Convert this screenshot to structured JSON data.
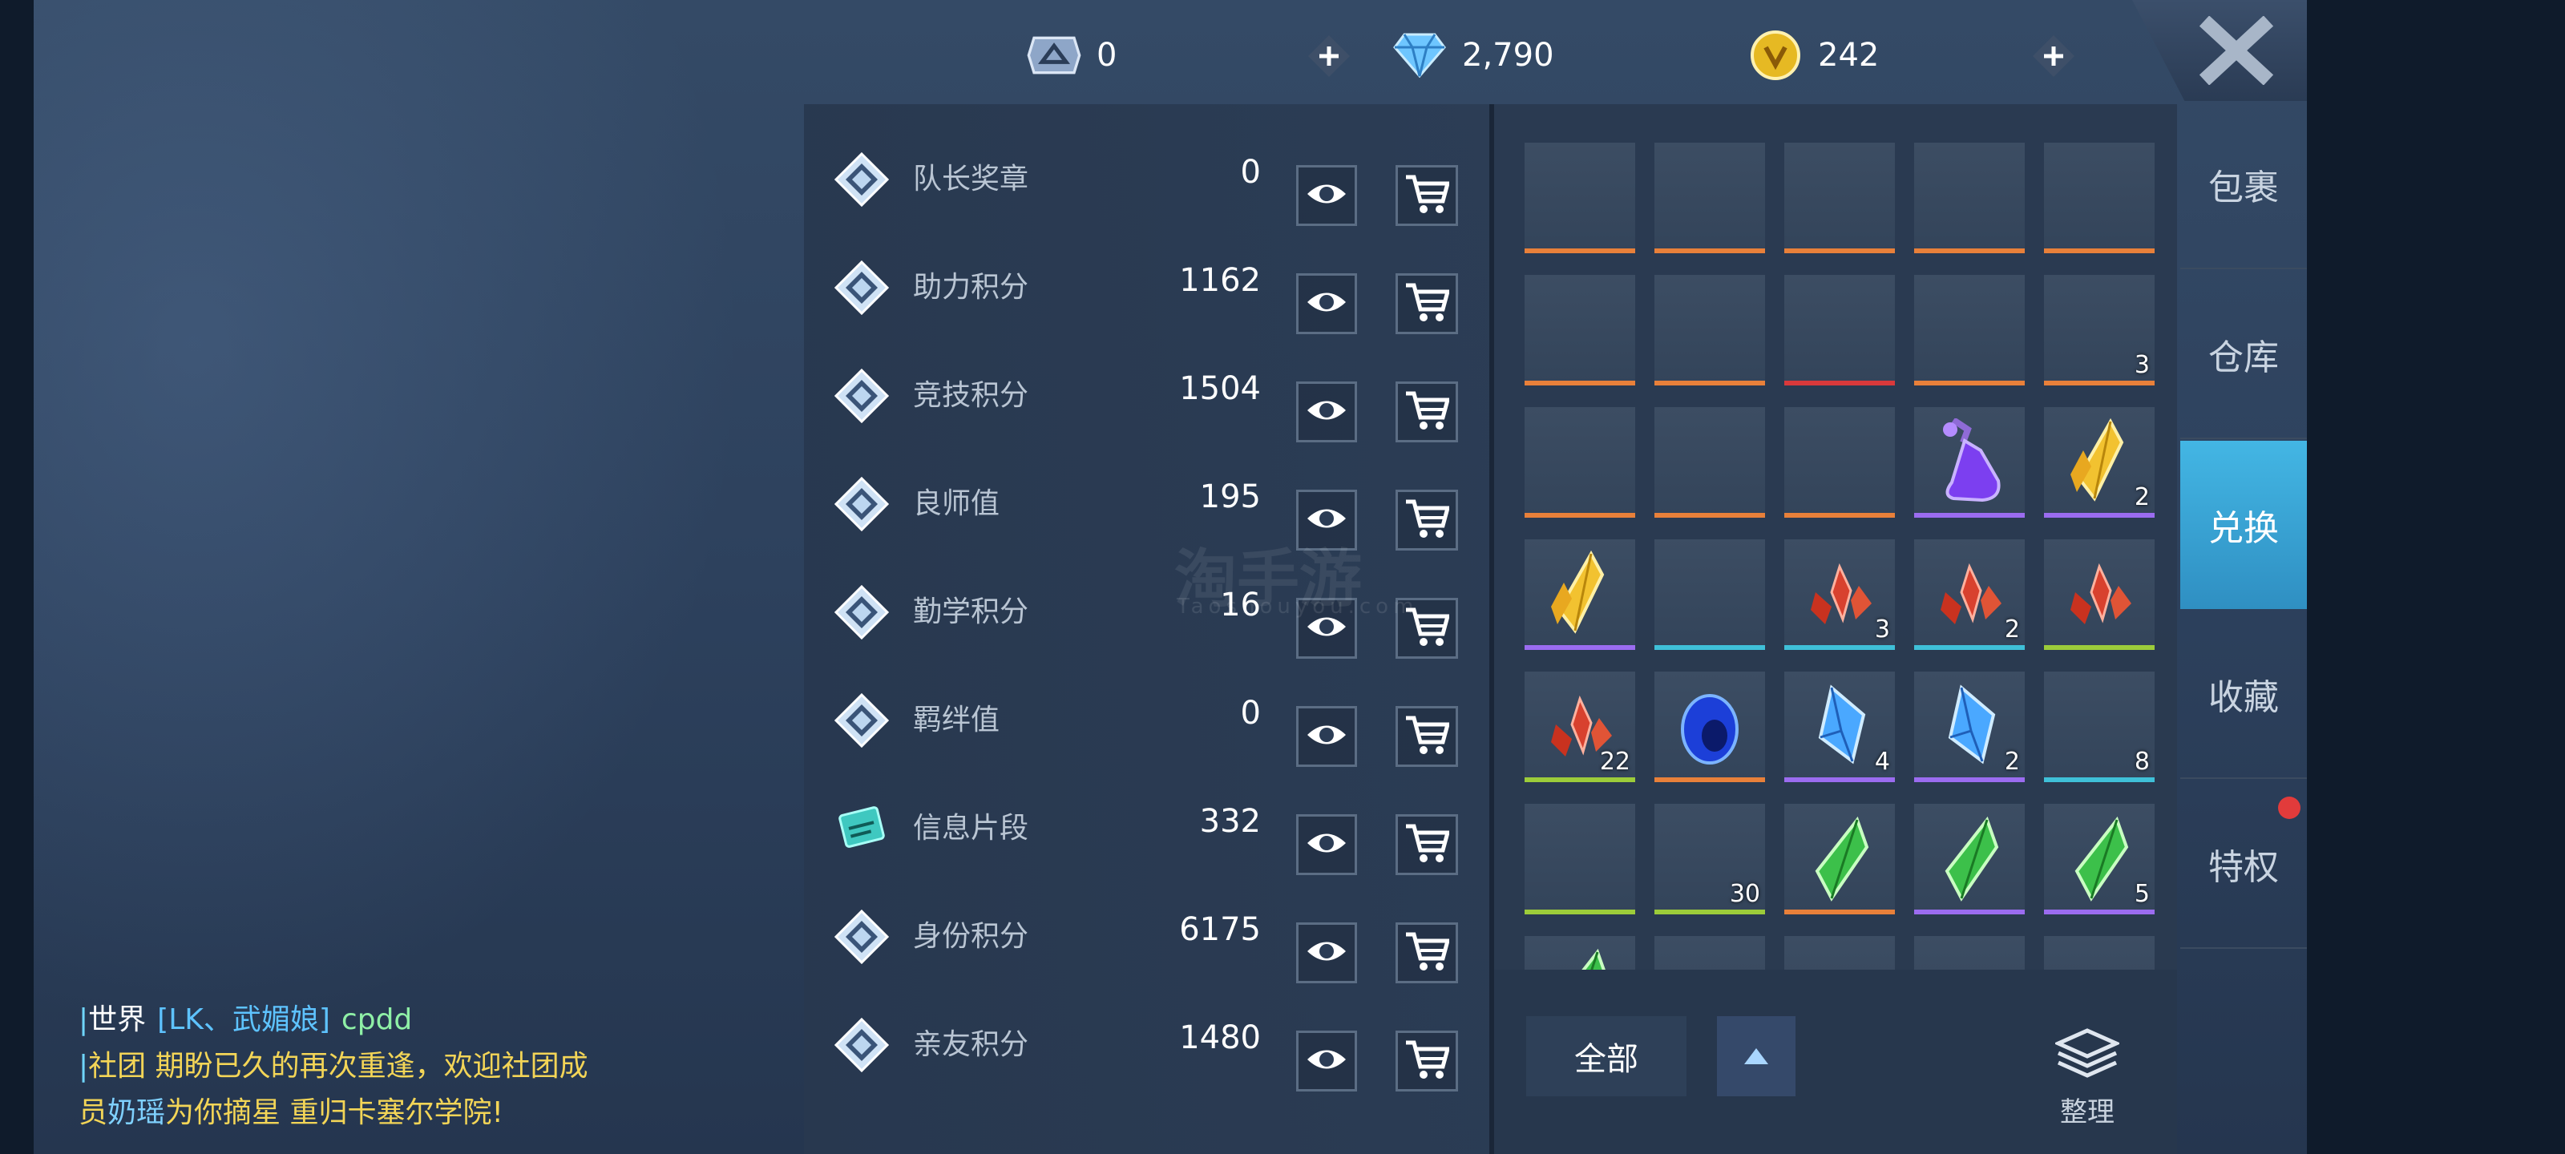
{
  "currencies": {
    "medal": {
      "value": "0",
      "icon": "ticket-medal-icon"
    },
    "diamond": {
      "value": "2,790",
      "icon": "diamond-icon"
    },
    "coin": {
      "value": "242",
      "icon": "gold-coin-icon"
    }
  },
  "point_list": [
    {
      "name": "队长奖章",
      "value": "0",
      "icon": "diamond-emblem-icon"
    },
    {
      "name": "助力积分",
      "value": "1162",
      "icon": "diamond-emblem-icon"
    },
    {
      "name": "竞技积分",
      "value": "1504",
      "icon": "diamond-emblem-icon"
    },
    {
      "name": "良师值",
      "value": "195",
      "icon": "diamond-emblem-icon"
    },
    {
      "name": "勤学积分",
      "value": "16",
      "icon": "diamond-emblem-icon"
    },
    {
      "name": "羁绊值",
      "value": "0",
      "icon": "diamond-emblem-icon"
    },
    {
      "name": "信息片段",
      "value": "332",
      "icon": "info-fragment-icon"
    },
    {
      "name": "身份积分",
      "value": "6175",
      "icon": "diamond-emblem-icon"
    },
    {
      "name": "亲友积分",
      "value": "1480",
      "icon": "diamond-emblem-icon"
    }
  ],
  "inventory": [
    {
      "bar": "#e8803a",
      "count": "",
      "item": ""
    },
    {
      "bar": "#e8803a",
      "count": "",
      "item": ""
    },
    {
      "bar": "#e8803a",
      "count": "",
      "item": ""
    },
    {
      "bar": "#e8803a",
      "count": "",
      "item": ""
    },
    {
      "bar": "#e8803a",
      "count": "",
      "item": ""
    },
    {
      "bar": "#e8803a",
      "count": "",
      "item": ""
    },
    {
      "bar": "#e8803a",
      "count": "",
      "item": ""
    },
    {
      "bar": "#d9393b",
      "count": "",
      "item": ""
    },
    {
      "bar": "#e8803a",
      "count": "",
      "item": ""
    },
    {
      "bar": "#e8803a",
      "count": "3",
      "item": ""
    },
    {
      "bar": "#e8803a",
      "count": "",
      "item": ""
    },
    {
      "bar": "#e8803a",
      "count": "",
      "item": ""
    },
    {
      "bar": "#e8803a",
      "count": "",
      "item": ""
    },
    {
      "bar": "#9b6cf0",
      "count": "",
      "item": "potion"
    },
    {
      "bar": "#9b6cf0",
      "count": "2",
      "item": "gold-crystal"
    },
    {
      "bar": "#9b6cf0",
      "count": "",
      "item": "gold-crystal"
    },
    {
      "bar": "#3fc0d8",
      "count": "",
      "item": ""
    },
    {
      "bar": "#3fc0d8",
      "count": "3",
      "item": "red-crystal"
    },
    {
      "bar": "#3fc0d8",
      "count": "2",
      "item": "red-crystal"
    },
    {
      "bar": "#9ccc3a",
      "count": "",
      "item": "red-crystal"
    },
    {
      "bar": "#9ccc3a",
      "count": "22",
      "item": "red-crystal"
    },
    {
      "bar": "#e8803a",
      "count": "",
      "item": "blue-orb"
    },
    {
      "bar": "#9b6cf0",
      "count": "4",
      "item": "blue-crystal"
    },
    {
      "bar": "#9b6cf0",
      "count": "2",
      "item": "blue-crystal"
    },
    {
      "bar": "#3fc0d8",
      "count": "8",
      "item": ""
    },
    {
      "bar": "#9ccc3a",
      "count": "",
      "item": ""
    },
    {
      "bar": "#9ccc3a",
      "count": "30",
      "item": ""
    },
    {
      "bar": "#e8803a",
      "count": "",
      "item": "green-crystal"
    },
    {
      "bar": "#9b6cf0",
      "count": "",
      "item": "green-crystal"
    },
    {
      "bar": "#9b6cf0",
      "count": "5",
      "item": "green-crystal"
    },
    {
      "bar": "",
      "count": "",
      "item": "green-crystal"
    },
    {
      "bar": "",
      "count": "",
      "item": ""
    },
    {
      "bar": "",
      "count": "",
      "item": ""
    },
    {
      "bar": "",
      "count": "",
      "item": ""
    },
    {
      "bar": "",
      "count": "",
      "item": ""
    }
  ],
  "bottom": {
    "filter_label": "全部",
    "sort_label": "整理"
  },
  "tabs": [
    {
      "label": "包裹"
    },
    {
      "label": "仓库"
    },
    {
      "label": "兑换",
      "active": true
    },
    {
      "label": "收藏"
    },
    {
      "label": "特权",
      "notification": true
    }
  ],
  "chat": {
    "line1": {
      "channel": "世界",
      "sender": "[LK、武媚娘]",
      "message": "cpdd"
    },
    "line2": {
      "channel": "社团",
      "message_a": "期盼已久的再次重逢，欢迎社团成",
      "message_b": "员",
      "member": "奶瑶",
      "message_c": "为你摘星",
      "message_d": "重归卡塞尔学院!"
    }
  },
  "watermark": {
    "text": "淘手游",
    "sub": "Taoshouyou.com"
  }
}
